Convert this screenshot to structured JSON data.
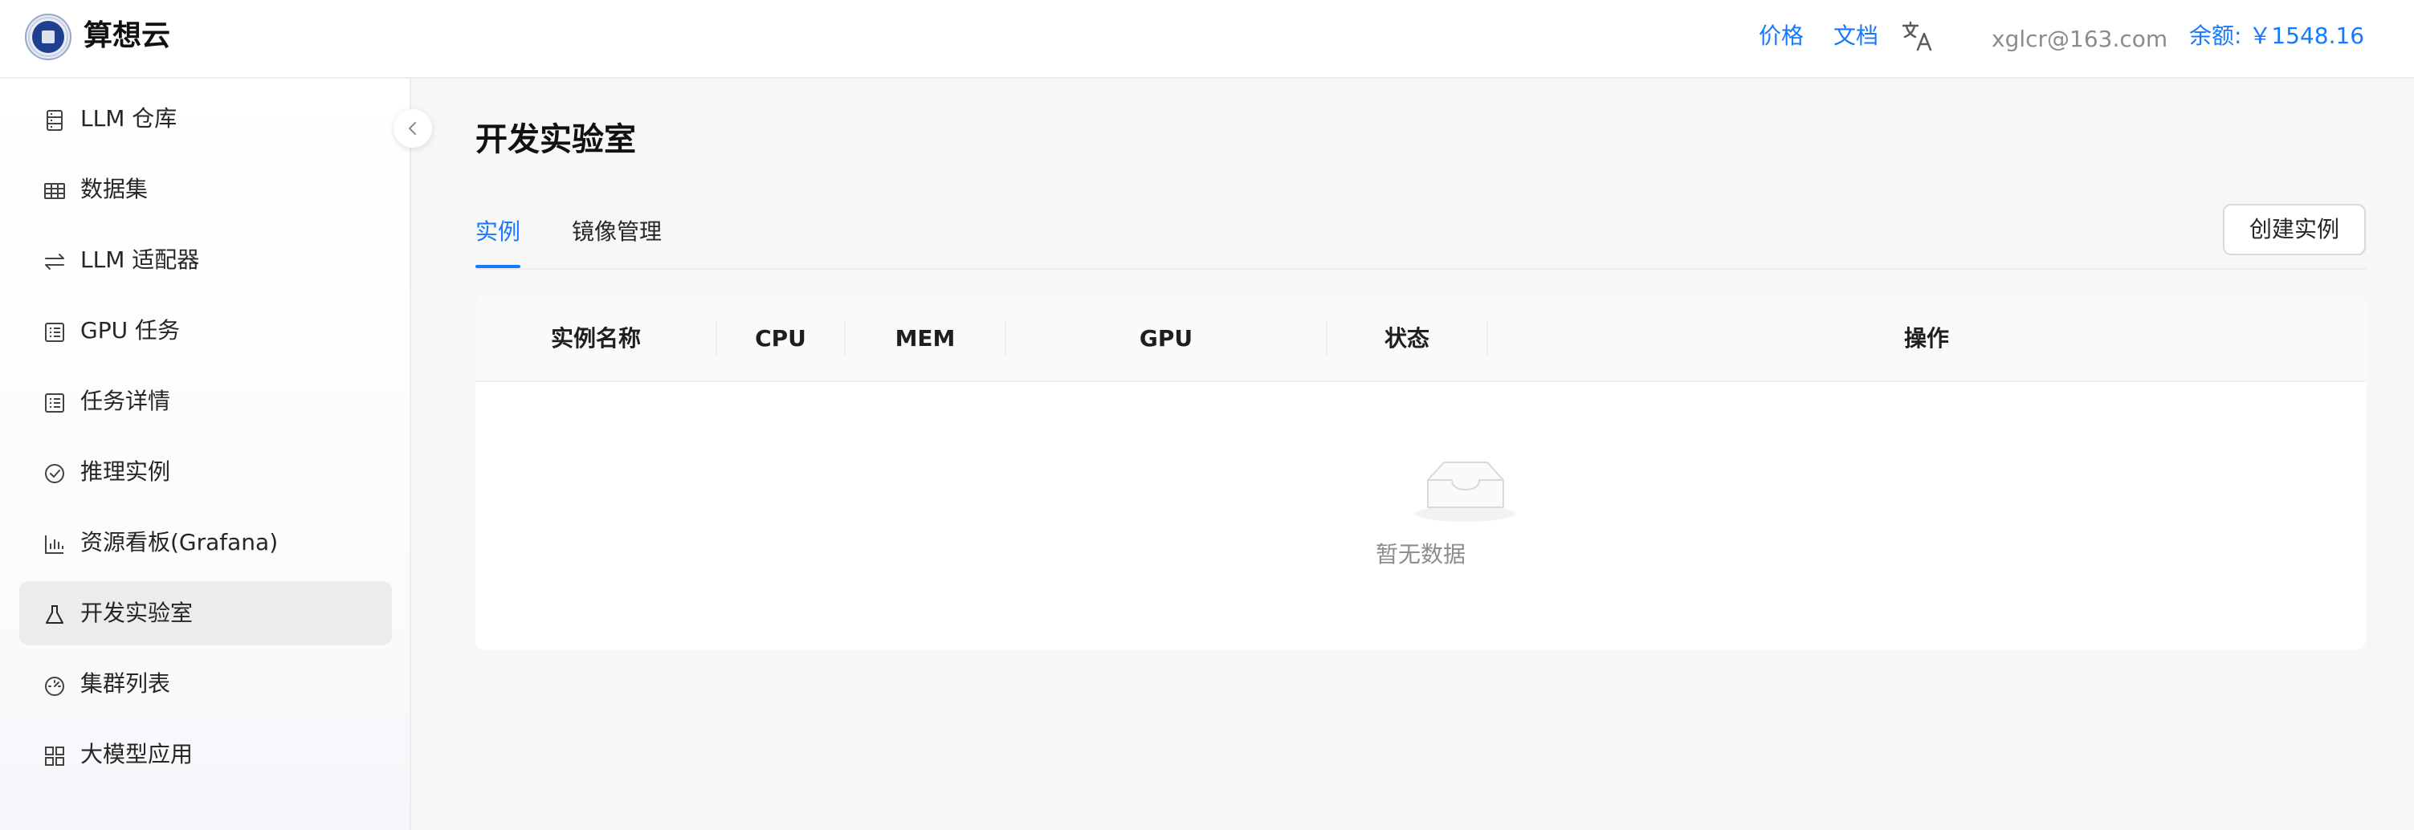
{
  "header": {
    "brand": "算想云",
    "price_link": "价格",
    "docs_link": "文档",
    "email": "xglcr@163.com",
    "balance": "余额: ￥1548.16"
  },
  "sidebar": {
    "items": [
      {
        "label": "LLM 仓库",
        "icon": "database-icon"
      },
      {
        "label": "数据集",
        "icon": "table-icon"
      },
      {
        "label": "LLM 适配器",
        "icon": "swap-icon"
      },
      {
        "label": "GPU 任务",
        "icon": "list-icon"
      },
      {
        "label": "任务详情",
        "icon": "list-icon"
      },
      {
        "label": "推理实例",
        "icon": "check-circle-icon"
      },
      {
        "label": "资源看板(Grafana)",
        "icon": "bar-chart-icon"
      },
      {
        "label": "开发实验室",
        "icon": "flask-icon",
        "active": true
      },
      {
        "label": "集群列表",
        "icon": "dashboard-icon"
      },
      {
        "label": "大模型应用",
        "icon": "grid-icon"
      }
    ]
  },
  "main": {
    "title": "开发实验室",
    "tabs": [
      {
        "label": "实例",
        "active": true
      },
      {
        "label": "镜像管理",
        "active": false
      }
    ],
    "create_button": "创建实例",
    "table": {
      "columns": [
        "实例名称",
        "CPU",
        "MEM",
        "GPU",
        "状态",
        "操作"
      ],
      "empty_text": "暂无数据"
    }
  },
  "colors": {
    "accent": "#1677ff",
    "active_nav_bg": "#ececed"
  }
}
